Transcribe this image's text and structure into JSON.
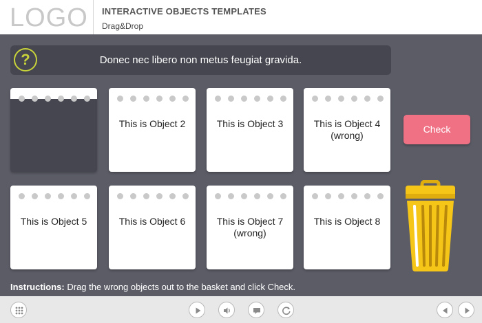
{
  "header": {
    "logo": "LOGO",
    "title": "INTERACTIVE OBJECTS TEMPLATES",
    "subtitle": "Drag&Drop"
  },
  "question": {
    "icon": "question-icon",
    "text": "Donec nec libero non metus feugiat gravida."
  },
  "cards": [
    {
      "label": ""
    },
    {
      "label": "This is Object 2"
    },
    {
      "label": "This is Object 3"
    },
    {
      "label": "This is Object 4 (wrong)"
    },
    {
      "label": "This is Object 5"
    },
    {
      "label": "This is Object 6"
    },
    {
      "label": "This is Object 7 (wrong)"
    },
    {
      "label": "This is Object 8"
    }
  ],
  "check_button": "Check",
  "trash_icon": "trash-can-icon",
  "instructions": {
    "prefix": "Instructions:",
    "text": " Drag the wrong objects out to the basket and click Check."
  },
  "footer": {
    "icons": [
      "menu-grid-icon",
      "play-icon",
      "volume-icon",
      "subtitles-icon",
      "replay-icon",
      "previous-icon",
      "next-icon"
    ]
  },
  "colors": {
    "background": "#5b5c66",
    "panel": "#45464f",
    "accent": "#c8d33a",
    "check_button": "#f07084",
    "trash": "#f5c518"
  }
}
